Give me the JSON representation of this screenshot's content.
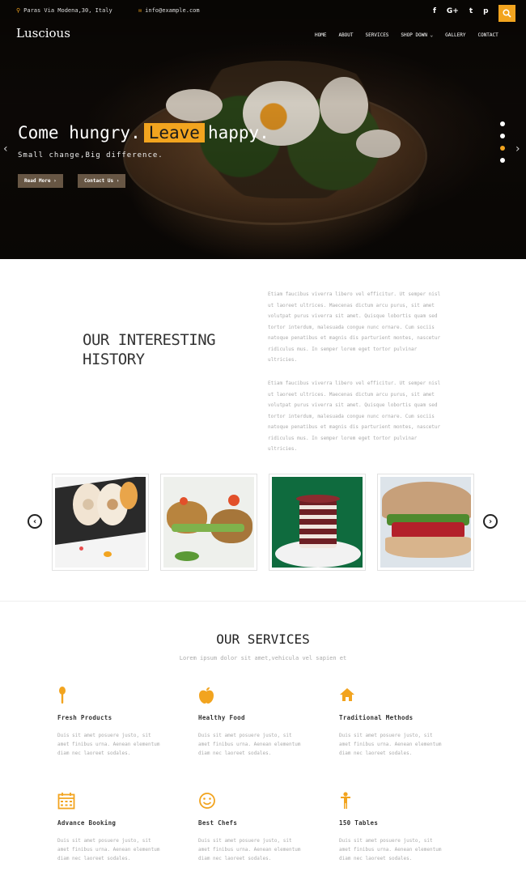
{
  "topbar": {
    "address": "Paras Via Modena,30, Italy",
    "email": "info@example.com",
    "social": [
      "f",
      "G+",
      "t",
      "p"
    ]
  },
  "header": {
    "logo": "Luscious",
    "nav": [
      "HOME",
      "ABOUT",
      "SERVICES",
      "SHOP DOWN ⌄",
      "GALLERY",
      "CONTACT"
    ]
  },
  "hero": {
    "title_before": "Come hungry.",
    "title_highlight": "Leave",
    "title_after": "happy.",
    "subtitle": "Small change,Big difference.",
    "read_more": "Read More ›",
    "contact_us": "Contact Us ›"
  },
  "history": {
    "title_line1": "OUR INTERESTING",
    "title_line2": "HISTORY",
    "paragraph1": "Etiam faucibus viverra libero vel efficitur. Ut semper nisl ut laoreet ultrices. Maecenas dictum arcu purus, sit amet volutpat purus viverra sit amet. Quisque lobortis quam sed tortor interdum, malesuada congue nunc ornare. Cum sociis natoque penatibus et magnis dis parturient montes, nascetur ridiculus mus. In semper lorem eget tortor pulvinar ultricies.",
    "paragraph2": "Etiam faucibus viverra libero vel efficitur. Ut semper nisl ut laoreet ultrices. Maecenas dictum arcu purus, sit amet volutpat purus viverra sit amet. Quisque lobortis quam sed tortor interdum, malesuada congue nunc ornare. Cum sociis natoque penatibus et magnis dis parturient montes, nascetur ridiculus mus. In semper lorem eget tortor pulvinar ultricies."
  },
  "services": {
    "title": "OUR SERVICES",
    "subtitle": "Lorem ipsum dolor sit amet,vehicula vel sapien et",
    "items": [
      {
        "icon": "spoon-icon",
        "title": "Fresh Products",
        "text": "Duis sit amet posuere justo, sit amet finibus urna. Aenean elementum diam nec laoreet sodales."
      },
      {
        "icon": "apple-icon",
        "title": "Healthy Food",
        "text": "Duis sit amet posuere justo, sit amet finibus urna. Aenean elementum diam nec laoreet sodales."
      },
      {
        "icon": "home-icon",
        "title": "Traditional Methods",
        "text": "Duis sit amet posuere justo, sit amet finibus urna. Aenean elementum diam nec laoreet sodales."
      },
      {
        "icon": "calendar-icon",
        "title": "Advance Booking",
        "text": "Duis sit amet posuere justo, sit amet finibus urna. Aenean elementum diam nec laoreet sodales."
      },
      {
        "icon": "smile-icon",
        "title": "Best Chefs",
        "text": "Duis sit amet posuere justo, sit amet finibus urna. Aenean elementum diam nec laoreet sodales."
      },
      {
        "icon": "person-icon",
        "title": "150 Tables",
        "text": "Duis sit amet posuere justo, sit amet finibus urna. Aenean elementum diam nec laoreet sodales."
      }
    ]
  },
  "colors": {
    "accent": "#f2a41f",
    "text_dark": "#333333",
    "text_muted": "#aaaaaa"
  }
}
